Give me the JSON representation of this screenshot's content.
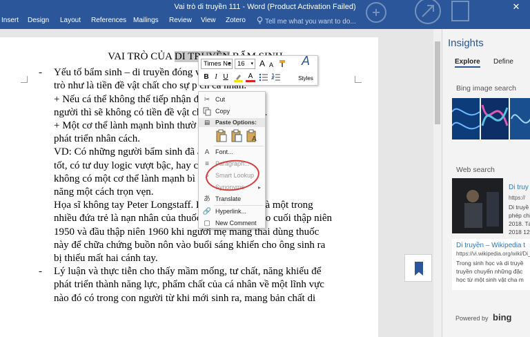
{
  "window": {
    "title": "Vai trò di truyền 111 - Word (Product Activation Failed)",
    "close_glyph": "✕"
  },
  "ribbon": {
    "tabs": [
      "Insert",
      "Design",
      "Layout",
      "References",
      "Mailings",
      "Review",
      "View",
      "Zotero"
    ],
    "tell_me": "Tell me what you want to do..."
  },
  "document": {
    "title_pre": "VAI TRÒ CỦA ",
    "title_hl": "DI TRUYỀN",
    "title_post": " BẨM SINH",
    "lines": [
      "Yếu tố bẩm sinh – di truyền đóng v                    g, nó đóng vai",
      "trò như là tiền đề vật chất cho sự p                     ch cá nhân.",
      "+ Nếu cá thể không thể tiếp nhận đ                   truyền của con",
      "người thì sẽ không có tiền đề vật ch                   riển nhân cách.",
      "+ Một cơ thể lành mạnh bình thườ                     thuận lợi cho sự",
      "phát triển nhân cách.",
      "VD: Có những người bẩm sinh đã                         ả năng cảm âm",
      "tốt, có tư duy logic vượt bậc, hay c                     thụ cái đẹp nếu",
      "không có một cơ thể lành mạnh bì                        khó phát huy tài",
      "năng một cách trọn vẹn.",
      "Họa sĩ không tay Peter Longstaff.  Peter Longstaff  là một trong",
      "nhiều đứa trẻ là nạn nhân của thuốc thalidomide vào cuối thập niên",
      "1950 và đầu thập niên 1960 khi người mẹ mang thai dùng thuốc",
      "này để chữa chứng buồn nôn vào buổi sáng khiến cho ông sinh ra",
      "bị thiếu mất hai cánh tay.",
      "Lý luận và thực tiễn cho thấy mầm mống, tư chất, năng khiếu để",
      "phát triển thành năng lực, phẩm chất của cá nhân về một lĩnh vực",
      "nào đó có trong con người từ khi mới sinh ra, mang bản chất di"
    ],
    "bullet": "-"
  },
  "mini_toolbar": {
    "font": "Times Ne",
    "size": "16",
    "grow": "A",
    "shrink": "A",
    "bold": "B",
    "italic": "I",
    "underline": "U",
    "font_color": "A",
    "styles_label": "Styles",
    "styles_glyph": "A"
  },
  "context_menu": {
    "cut": "Cut",
    "copy": "Copy",
    "paste_options": "Paste Options:",
    "font": "Font...",
    "paragraph": "Paragraph...",
    "smart_lookup": "Smart Lookup",
    "synonyms": "Synonyms",
    "translate": "Translate",
    "hyperlink": "Hyperlink...",
    "new_comment": "New Comment",
    "font_glyph": "A"
  },
  "insights": {
    "title": "Insights",
    "tabs": [
      "Explore",
      "Define"
    ],
    "bing_images": "Bing image search",
    "web_search": "Web search",
    "result1": {
      "title": "Di truy",
      "url": "https://",
      "snippet": [
        "Di truyề",
        "phép chi",
        "2018. Tá",
        "2018 12"
      ]
    },
    "result2": {
      "title": "Di truyền – Wikipedia t",
      "url": "https://vi.wikipedia.org/wiki/Di_truyền",
      "snippet": [
        "Trong sinh học và di truyề",
        "truyền chuyển những đặc",
        "học từ một sinh vật cha m"
      ]
    },
    "powered_by": "Powered by",
    "bing": "bing"
  },
  "colors": {
    "ribbon": "#2b579a",
    "accent_red": "#d63c3c",
    "link": "#2b79c0"
  }
}
